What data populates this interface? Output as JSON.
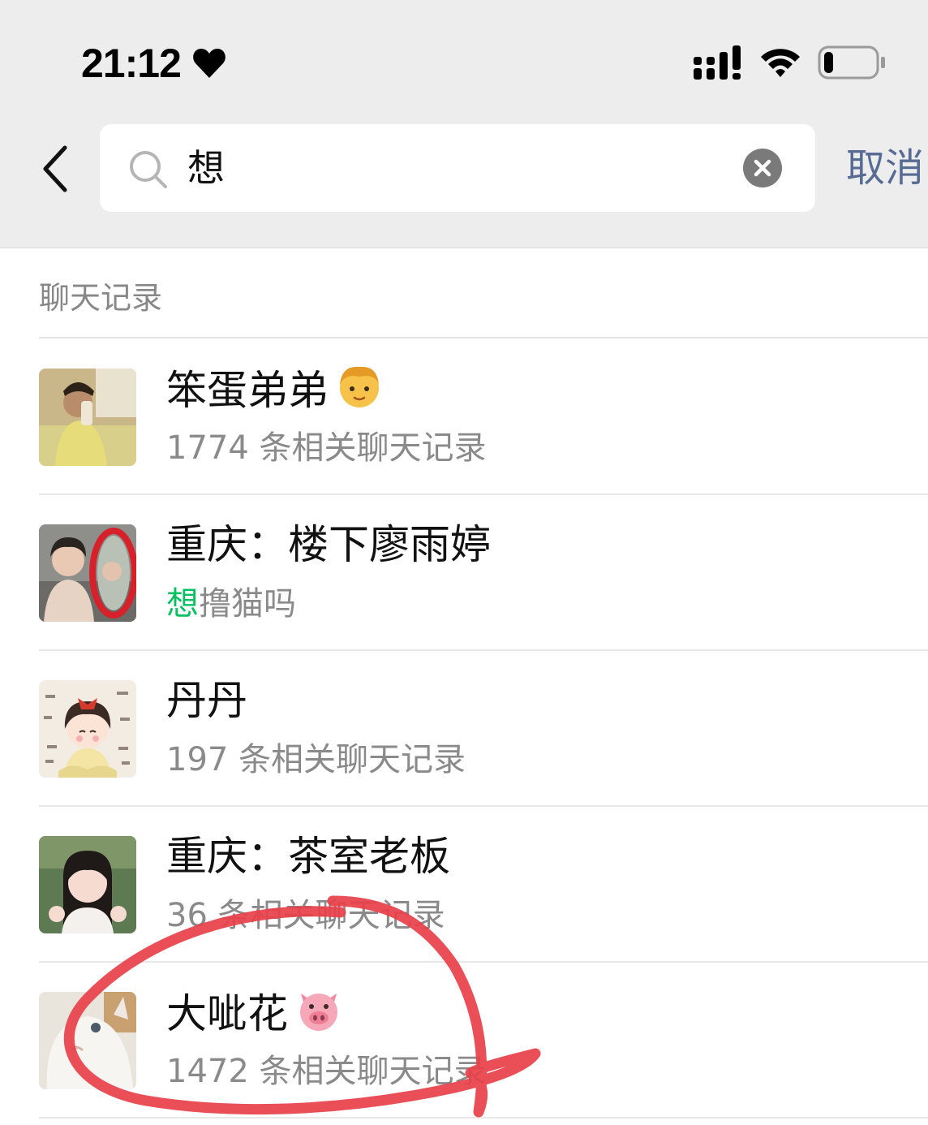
{
  "status_bar": {
    "time": "21:12",
    "heart_icon": "heart-icon",
    "signal_icon": "cellular-signal-icon",
    "wifi_icon": "wifi-icon",
    "battery_icon": "battery-low-icon",
    "battery_level": 0.18
  },
  "search": {
    "back_icon": "chevron-left-icon",
    "search_icon": "search-icon",
    "query": "想",
    "clear_icon": "clear-icon",
    "cancel_label": "取消"
  },
  "section": {
    "title": "聊天记录"
  },
  "results": [
    {
      "name": "笨蛋弟弟",
      "emoji": "boy-emoji",
      "subtitle": "1774 条相关聊天记录",
      "highlight": "",
      "subtitle_rest": ""
    },
    {
      "name": "重庆：楼下廖雨婷",
      "emoji": "",
      "subtitle": "",
      "highlight": "想",
      "subtitle_rest": "撸猫吗"
    },
    {
      "name": "丹丹",
      "emoji": "",
      "subtitle": "197 条相关聊天记录",
      "highlight": "",
      "subtitle_rest": ""
    },
    {
      "name": "重庆：茶室老板",
      "emoji": "",
      "subtitle": "36 条相关聊天记录",
      "highlight": "",
      "subtitle_rest": ""
    },
    {
      "name": "大呲花",
      "emoji": "pig-face-emoji",
      "subtitle": "1472 条相关聊天记录",
      "highlight": "",
      "subtitle_rest": ""
    }
  ],
  "colors": {
    "top_background": "#ededed",
    "link_blue": "#576b95",
    "highlight_green": "#07c160",
    "secondary_text": "#8a8a8a",
    "annotation_red": "#e8404a"
  }
}
